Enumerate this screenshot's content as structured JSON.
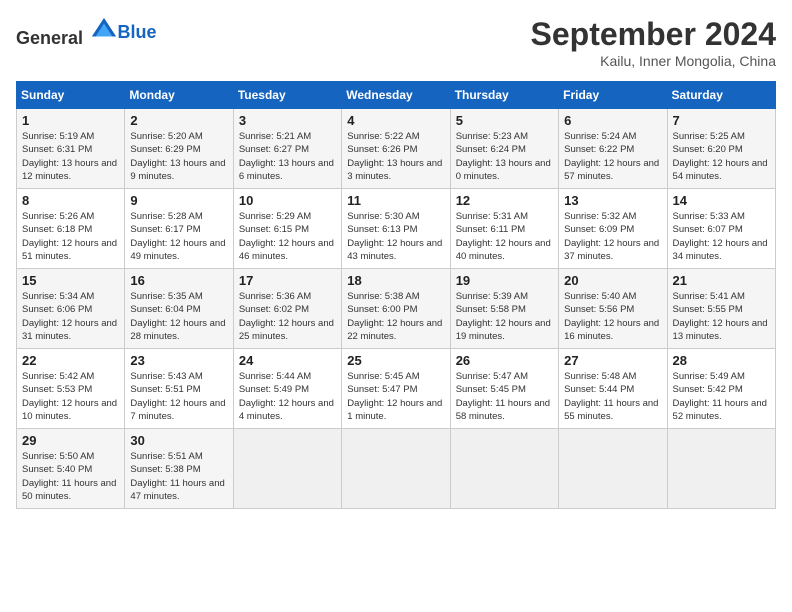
{
  "logo": {
    "general": "General",
    "blue": "Blue"
  },
  "title": "September 2024",
  "location": "Kailu, Inner Mongolia, China",
  "days_header": [
    "Sunday",
    "Monday",
    "Tuesday",
    "Wednesday",
    "Thursday",
    "Friday",
    "Saturday"
  ],
  "weeks": [
    [
      {
        "day": "1",
        "sunrise": "Sunrise: 5:19 AM",
        "sunset": "Sunset: 6:31 PM",
        "daylight": "Daylight: 13 hours and 12 minutes."
      },
      {
        "day": "2",
        "sunrise": "Sunrise: 5:20 AM",
        "sunset": "Sunset: 6:29 PM",
        "daylight": "Daylight: 13 hours and 9 minutes."
      },
      {
        "day": "3",
        "sunrise": "Sunrise: 5:21 AM",
        "sunset": "Sunset: 6:27 PM",
        "daylight": "Daylight: 13 hours and 6 minutes."
      },
      {
        "day": "4",
        "sunrise": "Sunrise: 5:22 AM",
        "sunset": "Sunset: 6:26 PM",
        "daylight": "Daylight: 13 hours and 3 minutes."
      },
      {
        "day": "5",
        "sunrise": "Sunrise: 5:23 AM",
        "sunset": "Sunset: 6:24 PM",
        "daylight": "Daylight: 13 hours and 0 minutes."
      },
      {
        "day": "6",
        "sunrise": "Sunrise: 5:24 AM",
        "sunset": "Sunset: 6:22 PM",
        "daylight": "Daylight: 12 hours and 57 minutes."
      },
      {
        "day": "7",
        "sunrise": "Sunrise: 5:25 AM",
        "sunset": "Sunset: 6:20 PM",
        "daylight": "Daylight: 12 hours and 54 minutes."
      }
    ],
    [
      {
        "day": "8",
        "sunrise": "Sunrise: 5:26 AM",
        "sunset": "Sunset: 6:18 PM",
        "daylight": "Daylight: 12 hours and 51 minutes."
      },
      {
        "day": "9",
        "sunrise": "Sunrise: 5:28 AM",
        "sunset": "Sunset: 6:17 PM",
        "daylight": "Daylight: 12 hours and 49 minutes."
      },
      {
        "day": "10",
        "sunrise": "Sunrise: 5:29 AM",
        "sunset": "Sunset: 6:15 PM",
        "daylight": "Daylight: 12 hours and 46 minutes."
      },
      {
        "day": "11",
        "sunrise": "Sunrise: 5:30 AM",
        "sunset": "Sunset: 6:13 PM",
        "daylight": "Daylight: 12 hours and 43 minutes."
      },
      {
        "day": "12",
        "sunrise": "Sunrise: 5:31 AM",
        "sunset": "Sunset: 6:11 PM",
        "daylight": "Daylight: 12 hours and 40 minutes."
      },
      {
        "day": "13",
        "sunrise": "Sunrise: 5:32 AM",
        "sunset": "Sunset: 6:09 PM",
        "daylight": "Daylight: 12 hours and 37 minutes."
      },
      {
        "day": "14",
        "sunrise": "Sunrise: 5:33 AM",
        "sunset": "Sunset: 6:07 PM",
        "daylight": "Daylight: 12 hours and 34 minutes."
      }
    ],
    [
      {
        "day": "15",
        "sunrise": "Sunrise: 5:34 AM",
        "sunset": "Sunset: 6:06 PM",
        "daylight": "Daylight: 12 hours and 31 minutes."
      },
      {
        "day": "16",
        "sunrise": "Sunrise: 5:35 AM",
        "sunset": "Sunset: 6:04 PM",
        "daylight": "Daylight: 12 hours and 28 minutes."
      },
      {
        "day": "17",
        "sunrise": "Sunrise: 5:36 AM",
        "sunset": "Sunset: 6:02 PM",
        "daylight": "Daylight: 12 hours and 25 minutes."
      },
      {
        "day": "18",
        "sunrise": "Sunrise: 5:38 AM",
        "sunset": "Sunset: 6:00 PM",
        "daylight": "Daylight: 12 hours and 22 minutes."
      },
      {
        "day": "19",
        "sunrise": "Sunrise: 5:39 AM",
        "sunset": "Sunset: 5:58 PM",
        "daylight": "Daylight: 12 hours and 19 minutes."
      },
      {
        "day": "20",
        "sunrise": "Sunrise: 5:40 AM",
        "sunset": "Sunset: 5:56 PM",
        "daylight": "Daylight: 12 hours and 16 minutes."
      },
      {
        "day": "21",
        "sunrise": "Sunrise: 5:41 AM",
        "sunset": "Sunset: 5:55 PM",
        "daylight": "Daylight: 12 hours and 13 minutes."
      }
    ],
    [
      {
        "day": "22",
        "sunrise": "Sunrise: 5:42 AM",
        "sunset": "Sunset: 5:53 PM",
        "daylight": "Daylight: 12 hours and 10 minutes."
      },
      {
        "day": "23",
        "sunrise": "Sunrise: 5:43 AM",
        "sunset": "Sunset: 5:51 PM",
        "daylight": "Daylight: 12 hours and 7 minutes."
      },
      {
        "day": "24",
        "sunrise": "Sunrise: 5:44 AM",
        "sunset": "Sunset: 5:49 PM",
        "daylight": "Daylight: 12 hours and 4 minutes."
      },
      {
        "day": "25",
        "sunrise": "Sunrise: 5:45 AM",
        "sunset": "Sunset: 5:47 PM",
        "daylight": "Daylight: 12 hours and 1 minute."
      },
      {
        "day": "26",
        "sunrise": "Sunrise: 5:47 AM",
        "sunset": "Sunset: 5:45 PM",
        "daylight": "Daylight: 11 hours and 58 minutes."
      },
      {
        "day": "27",
        "sunrise": "Sunrise: 5:48 AM",
        "sunset": "Sunset: 5:44 PM",
        "daylight": "Daylight: 11 hours and 55 minutes."
      },
      {
        "day": "28",
        "sunrise": "Sunrise: 5:49 AM",
        "sunset": "Sunset: 5:42 PM",
        "daylight": "Daylight: 11 hours and 52 minutes."
      }
    ],
    [
      {
        "day": "29",
        "sunrise": "Sunrise: 5:50 AM",
        "sunset": "Sunset: 5:40 PM",
        "daylight": "Daylight: 11 hours and 50 minutes."
      },
      {
        "day": "30",
        "sunrise": "Sunrise: 5:51 AM",
        "sunset": "Sunset: 5:38 PM",
        "daylight": "Daylight: 11 hours and 47 minutes."
      },
      {
        "day": "",
        "sunrise": "",
        "sunset": "",
        "daylight": ""
      },
      {
        "day": "",
        "sunrise": "",
        "sunset": "",
        "daylight": ""
      },
      {
        "day": "",
        "sunrise": "",
        "sunset": "",
        "daylight": ""
      },
      {
        "day": "",
        "sunrise": "",
        "sunset": "",
        "daylight": ""
      },
      {
        "day": "",
        "sunrise": "",
        "sunset": "",
        "daylight": ""
      }
    ]
  ]
}
